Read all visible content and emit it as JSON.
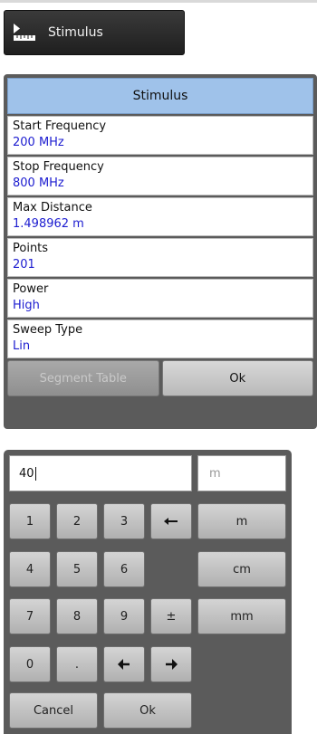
{
  "toolbar": {
    "stimulus_button": {
      "label": "Stimulus",
      "icon": "ruler-icon"
    }
  },
  "stimulus_menu": {
    "title": "Stimulus",
    "items": [
      {
        "label": "Start Frequency",
        "value": "200 MHz"
      },
      {
        "label": "Stop Frequency",
        "value": "800 MHz"
      },
      {
        "label": "Max Distance",
        "value": "1.498962 m"
      },
      {
        "label": "Points",
        "value": "201"
      },
      {
        "label": "Power",
        "value": "High"
      },
      {
        "label": "Sweep Type",
        "value": "Lin"
      }
    ],
    "segment_table_label": "Segment Table",
    "ok_label": "Ok"
  },
  "keypad": {
    "entry_value": "40",
    "unit_display": "m",
    "digits": [
      "1",
      "2",
      "3",
      "4",
      "5",
      "6",
      "7",
      "8",
      "9",
      "0"
    ],
    "decimal": ".",
    "plus_minus": "±",
    "backspace_icon": "backspace-arrow-icon",
    "units": [
      "m",
      "cm",
      "mm"
    ],
    "cancel_label": "Cancel",
    "ok_label": "Ok"
  },
  "colors": {
    "menu_header_bg": "#9fc2ea",
    "value_text": "#1c1cd0",
    "panel_bg": "#5b5b5b"
  }
}
